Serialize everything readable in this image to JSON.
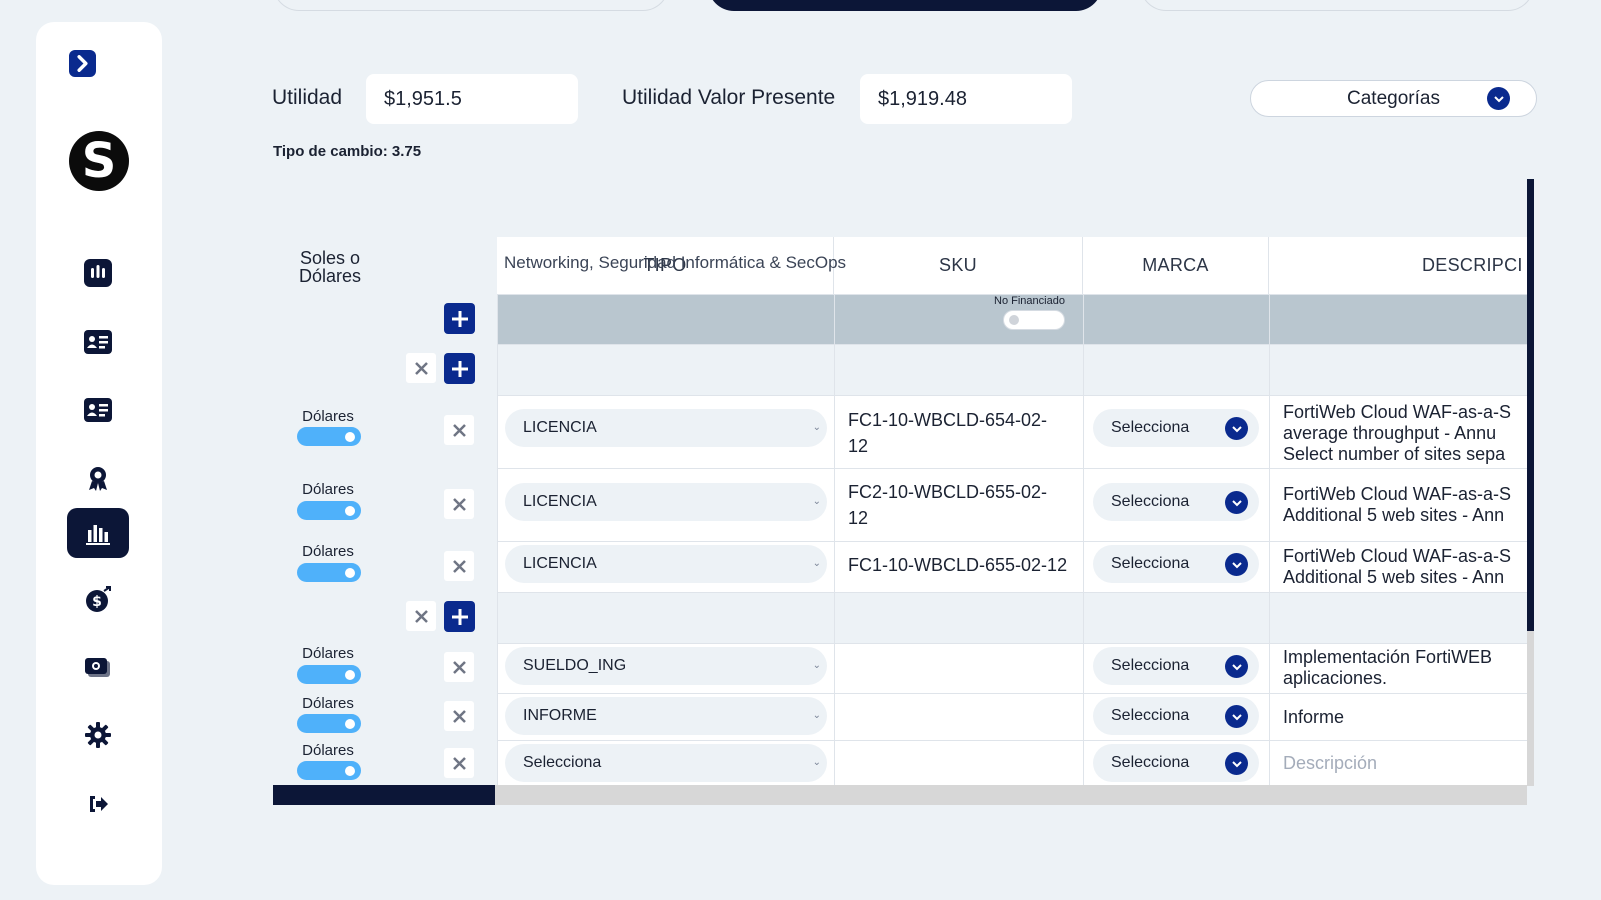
{
  "summary": {
    "utilidad_label": "Utilidad",
    "utilidad_value": "$1,951.5",
    "utilidad_vp_label": "Utilidad Valor Presente",
    "utilidad_vp_value": "$1,919.48",
    "tipo_cambio": "Tipo de cambio: 3.75",
    "categorias_label": "Categorías"
  },
  "logo_letter": "S",
  "sidebar": {
    "items": [
      {
        "icon": "dashboard-icon"
      },
      {
        "icon": "contact-card-icon"
      },
      {
        "icon": "contact-list-icon"
      },
      {
        "icon": "award-icon"
      },
      {
        "icon": "bar-chart-icon",
        "active": true
      },
      {
        "icon": "money-icon"
      },
      {
        "icon": "cash-icon"
      },
      {
        "icon": "gear-icon"
      },
      {
        "icon": "logout-icon"
      }
    ]
  },
  "table": {
    "soles_header": "Soles o Dólares",
    "columns": [
      "TIPO",
      "SKU",
      "MARCA",
      "DESCRIPCI"
    ],
    "group": {
      "name": "Networking, Seguridad Informática & SecOps",
      "toggle_label": "No Financiado"
    },
    "rows": [
      {
        "currency": "Dólares",
        "tipo": "LICENCIA",
        "sku1": "FC1-10-WBCLD-654-02-",
        "sku2": "12",
        "marca": "Selecciona",
        "desc1": "FortiWeb Cloud WAF-as-a-S",
        "desc2": "average throughput - Annu",
        "desc3": "Select number of sites sepa"
      },
      {
        "currency": "Dólares",
        "tipo": "LICENCIA",
        "sku1": "FC2-10-WBCLD-655-02-",
        "sku2": "12",
        "marca": "Selecciona",
        "desc1": "FortiWeb Cloud WAF-as-a-S",
        "desc2": "Additional 5 web sites - Ann"
      },
      {
        "currency": "Dólares",
        "tipo": "LICENCIA",
        "sku1": "FC1-10-WBCLD-655-02-12",
        "marca": "Selecciona",
        "desc1": "FortiWeb Cloud WAF-as-a-S",
        "desc2": "Additional 5 web sites - Ann"
      },
      {
        "currency": "Dólares",
        "tipo": "SUELDO_ING",
        "marca": "Selecciona",
        "desc1": "Implementación FortiWEB",
        "desc2": "aplicaciones."
      },
      {
        "currency": "Dólares",
        "tipo": "INFORME",
        "marca": "Selecciona",
        "desc1": "Informe"
      },
      {
        "currency": "Dólares",
        "tipo": "Selecciona",
        "marca": "Selecciona",
        "desc_placeholder": "Descripción"
      }
    ]
  },
  "colors": {
    "navy": "#0c1637",
    "accent": "#0a2a8e",
    "toggle_on": "#4fb1fa",
    "group_bg": "#b9c6cf"
  }
}
